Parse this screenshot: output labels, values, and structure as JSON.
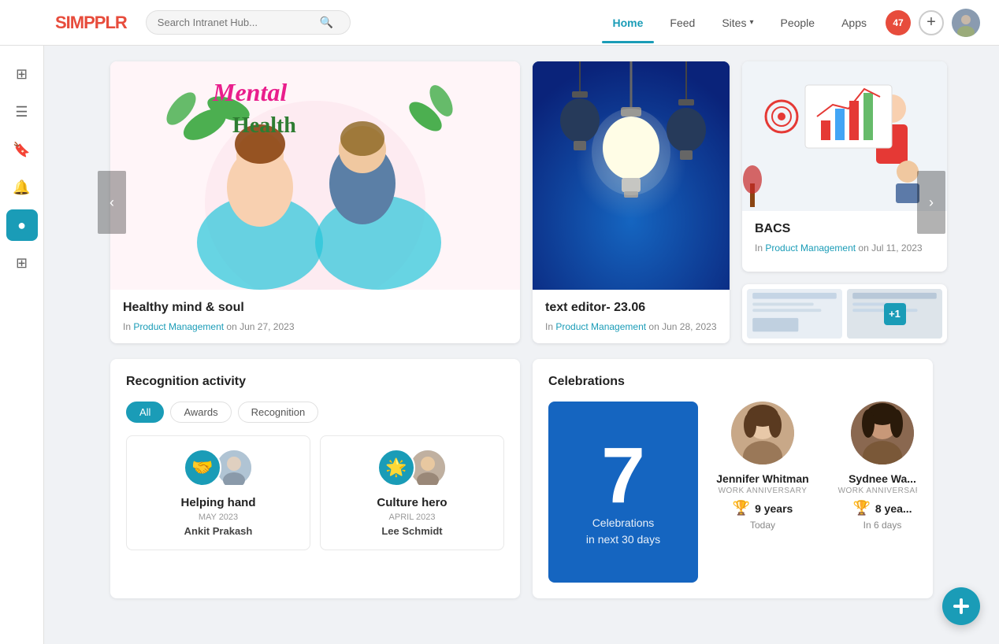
{
  "brand": {
    "logo_text": "SIMPPLR",
    "logo_accent": "S"
  },
  "search": {
    "placeholder": "Search Intranet Hub..."
  },
  "nav": {
    "links": [
      {
        "id": "home",
        "label": "Home",
        "active": true
      },
      {
        "id": "feed",
        "label": "Feed",
        "active": false
      },
      {
        "id": "sites",
        "label": "Sites",
        "active": false,
        "has_dropdown": true
      },
      {
        "id": "people",
        "label": "People",
        "active": false
      },
      {
        "id": "apps",
        "label": "Apps",
        "active": false,
        "has_dropdown": true
      }
    ],
    "notification_count": "47"
  },
  "carousel": {
    "cards": [
      {
        "id": "mental-health",
        "title": "Healthy mind & soul",
        "category": "Product Management",
        "date": "Jun 27, 2023",
        "image_type": "mental-health"
      },
      {
        "id": "text-editor",
        "title": "text editor- 23.06",
        "category": "Product Management",
        "date": "Jun 28, 2023",
        "image_type": "lightbulb"
      },
      {
        "id": "bacs",
        "title": "BACS",
        "category": "Product Management",
        "date": "Jul 11, 2023",
        "image_type": "bacs"
      }
    ],
    "in_label": "In",
    "on_label": "on",
    "plus_count": "+1"
  },
  "recognition": {
    "section_title": "Recognition activity",
    "filters": [
      {
        "id": "all",
        "label": "All",
        "active": true
      },
      {
        "id": "awards",
        "label": "Awards",
        "active": false
      },
      {
        "id": "recognition",
        "label": "Recognition",
        "active": false
      }
    ],
    "items": [
      {
        "badge_emoji": "🤝",
        "title": "Helping hand",
        "month": "MAY 2023",
        "person": "Ankit Prakash"
      },
      {
        "badge_emoji": "🌟",
        "title": "Culture hero",
        "month": "APRIL 2023",
        "person": "Lee Schmidt"
      }
    ]
  },
  "celebrations": {
    "section_title": "Celebrations",
    "count": "7",
    "subtitle_line1": "Celebrations",
    "subtitle_line2": "in next 30 days",
    "people": [
      {
        "name": "Jennifer Whitman",
        "label": "WORK ANNIVERSARY",
        "years_text": "9 years",
        "date_text": "Today",
        "avatar_emoji": "👩"
      },
      {
        "name": "Sydnee Wa...",
        "label": "WORK ANNIVERSARY",
        "years_text": "8 yea...",
        "date_text": "In 6 days",
        "avatar_emoji": "👩🏾"
      }
    ]
  },
  "sidebar": {
    "icons": [
      {
        "id": "home",
        "symbol": "⊞",
        "active": false
      },
      {
        "id": "menu",
        "symbol": "☰",
        "active": false
      },
      {
        "id": "bookmark",
        "symbol": "🔖",
        "active": false
      },
      {
        "id": "bell",
        "symbol": "🔔",
        "active": false
      },
      {
        "id": "blue-active",
        "symbol": "●",
        "active": true
      },
      {
        "id": "grid",
        "symbol": "⊞",
        "active": false
      }
    ]
  },
  "product_label": "Product"
}
